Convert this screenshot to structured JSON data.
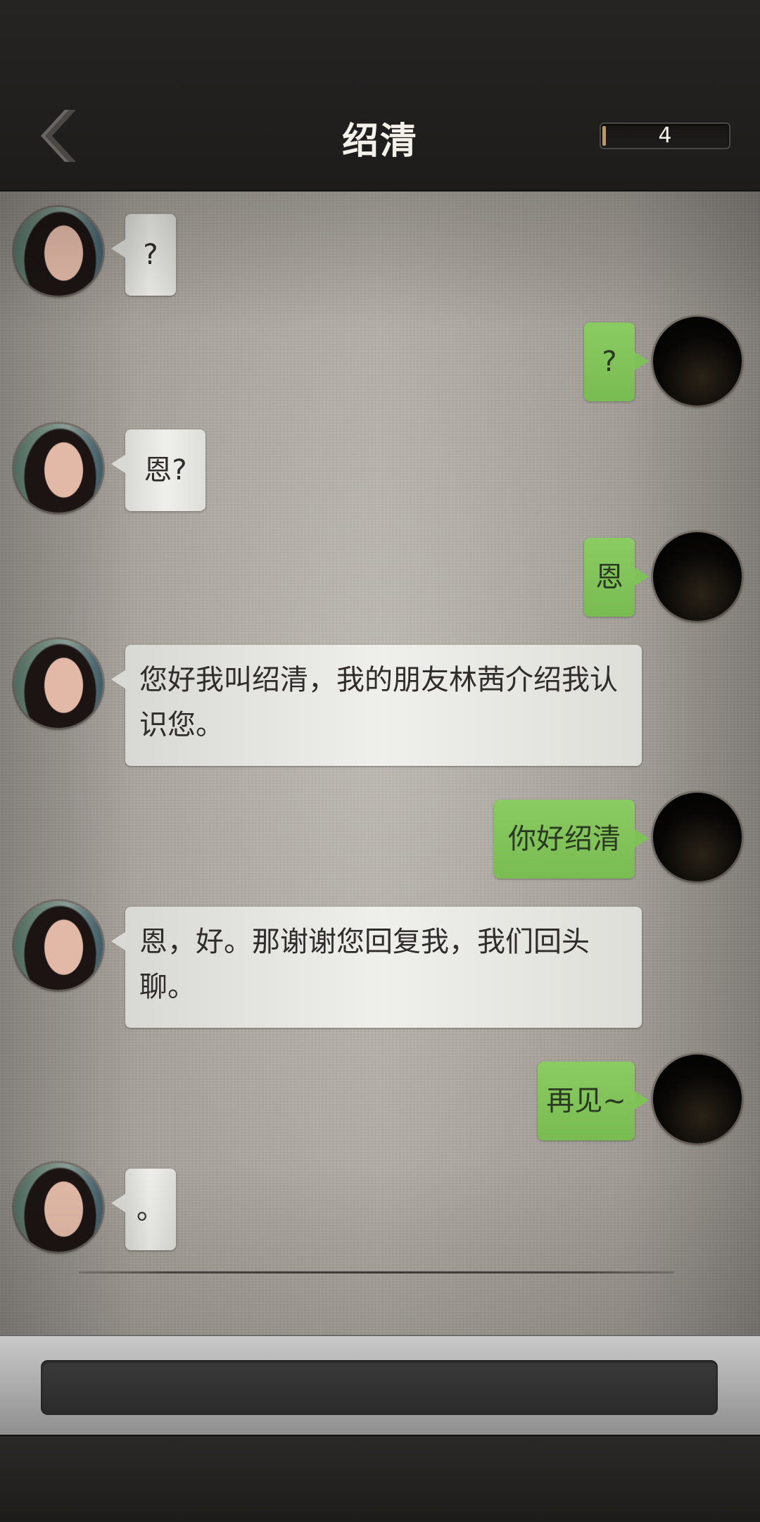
{
  "header": {
    "back_icon": "chevron-left-icon",
    "title": "绍清",
    "counter": "4"
  },
  "messages": [
    {
      "from": "contact",
      "text": "?"
    },
    {
      "from": "self",
      "text": "?"
    },
    {
      "from": "contact",
      "text": "恩?"
    },
    {
      "from": "self",
      "text": "恩"
    },
    {
      "from": "contact",
      "text": "您好我叫绍清，我的朋友林茜介绍我认识您。"
    },
    {
      "from": "self",
      "text": "你好绍清"
    },
    {
      "from": "contact",
      "text": "恩，好。那谢谢您回复我，我们回头聊。"
    },
    {
      "from": "self",
      "text": "再见~"
    },
    {
      "from": "contact",
      "text": "。"
    }
  ],
  "colors": {
    "self_bubble": "#7ec257",
    "contact_bubble": "#ebebe7",
    "header_bg": "#232120"
  }
}
